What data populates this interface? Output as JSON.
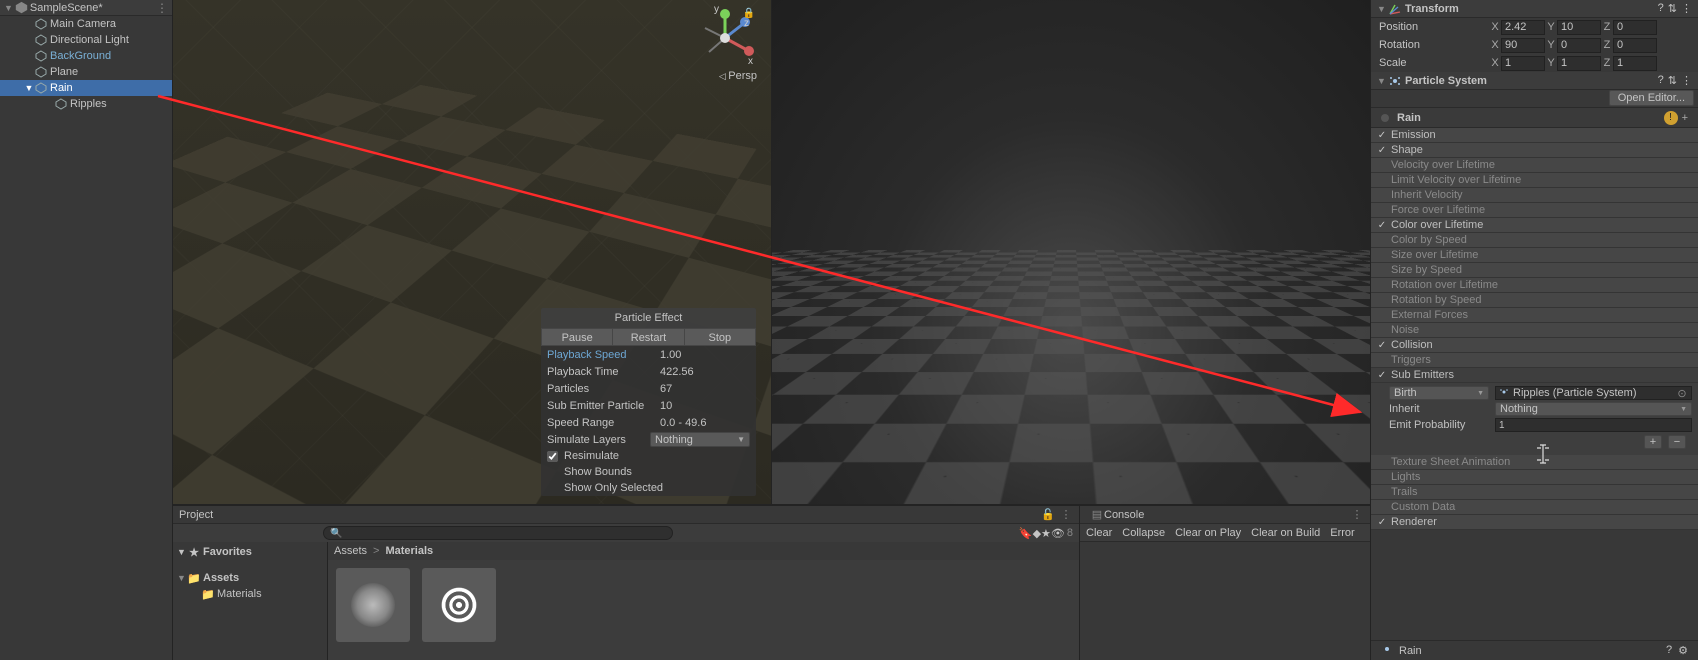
{
  "hierarchy": {
    "scene": "SampleScene*",
    "items": [
      {
        "label": "Main Camera",
        "icon": "cube",
        "indent": 1
      },
      {
        "label": "Directional Light",
        "icon": "cube",
        "indent": 1
      },
      {
        "label": "BackGround",
        "icon": "cube",
        "indent": 1,
        "style": "bg"
      },
      {
        "label": "Plane",
        "icon": "cube",
        "indent": 1
      },
      {
        "label": "Rain",
        "icon": "cube",
        "indent": 1,
        "selected": true,
        "expandable": true
      },
      {
        "label": "Ripples",
        "icon": "cube",
        "indent": 2
      }
    ]
  },
  "scene": {
    "persp": "Persp",
    "axes": {
      "x": "x",
      "y": "y",
      "z": "z"
    }
  },
  "particleEffect": {
    "title": "Particle Effect",
    "buttons": {
      "pause": "Pause",
      "restart": "Restart",
      "stop": "Stop"
    },
    "rows": [
      {
        "label": "Playback Speed",
        "value": "1.00",
        "hl": true
      },
      {
        "label": "Playback Time",
        "value": "422.56"
      },
      {
        "label": "Particles",
        "value": "67"
      },
      {
        "label": "Sub Emitter Particle",
        "value": "10"
      },
      {
        "label": "Speed Range",
        "value": "0.0 - 49.6"
      }
    ],
    "simLayers": {
      "label": "Simulate Layers",
      "value": "Nothing"
    },
    "checks": {
      "resimulate": "Resimulate",
      "showBounds": "Show Bounds",
      "showOnlySel": "Show Only Selected"
    },
    "resimChecked": true
  },
  "project": {
    "title": "Project",
    "favorites": "Favorites",
    "assets": "Assets",
    "folders": [
      {
        "label": "Materials"
      }
    ],
    "crumbs": {
      "root": "Assets",
      "sep": ">",
      "current": "Materials"
    }
  },
  "console": {
    "title": "Console",
    "buttons": {
      "clear": "Clear",
      "collapse": "Collapse",
      "clearPlay": "Clear on Play",
      "clearBuild": "Clear on Build",
      "error": "Error"
    },
    "hidden": "8"
  },
  "inspector": {
    "transform": {
      "title": "Transform",
      "rows": [
        {
          "label": "Position",
          "x": "2.42",
          "y": "10",
          "z": "0"
        },
        {
          "label": "Rotation",
          "x": "90",
          "y": "0",
          "z": "0"
        },
        {
          "label": "Scale",
          "x": "1",
          "y": "1",
          "z": "1"
        }
      ]
    },
    "particleSystem": {
      "title": "Particle System",
      "openEditor": "Open Editor...",
      "name": "Rain",
      "modules": [
        {
          "label": "Emission",
          "on": true
        },
        {
          "label": "Shape",
          "on": true
        },
        {
          "label": "Velocity over Lifetime",
          "on": false
        },
        {
          "label": "Limit Velocity over Lifetime",
          "on": false
        },
        {
          "label": "Inherit Velocity",
          "on": false
        },
        {
          "label": "Force over Lifetime",
          "on": false
        },
        {
          "label": "Color over Lifetime",
          "on": true
        },
        {
          "label": "Color by Speed",
          "on": false
        },
        {
          "label": "Size over Lifetime",
          "on": false
        },
        {
          "label": "Size by Speed",
          "on": false
        },
        {
          "label": "Rotation over Lifetime",
          "on": false
        },
        {
          "label": "Rotation by Speed",
          "on": false
        },
        {
          "label": "External Forces",
          "on": false
        },
        {
          "label": "Noise",
          "on": false
        },
        {
          "label": "Collision",
          "on": true
        },
        {
          "label": "Triggers",
          "on": false
        },
        {
          "label": "Sub Emitters",
          "on": true,
          "expanded": true
        }
      ],
      "subEmitters": {
        "birth": {
          "label": "Birth",
          "value": "Ripples (Particle System)"
        },
        "inherit": {
          "label": "Inherit",
          "value": "Nothing"
        },
        "emitProb": {
          "label": "Emit Probability",
          "value": "1"
        }
      },
      "tailModules": [
        {
          "label": "Texture Sheet Animation",
          "on": false
        },
        {
          "label": "Lights",
          "on": false
        },
        {
          "label": "Trails",
          "on": false
        },
        {
          "label": "Custom Data",
          "on": false
        },
        {
          "label": "Renderer",
          "on": true
        }
      ],
      "footer": "Rain"
    }
  }
}
